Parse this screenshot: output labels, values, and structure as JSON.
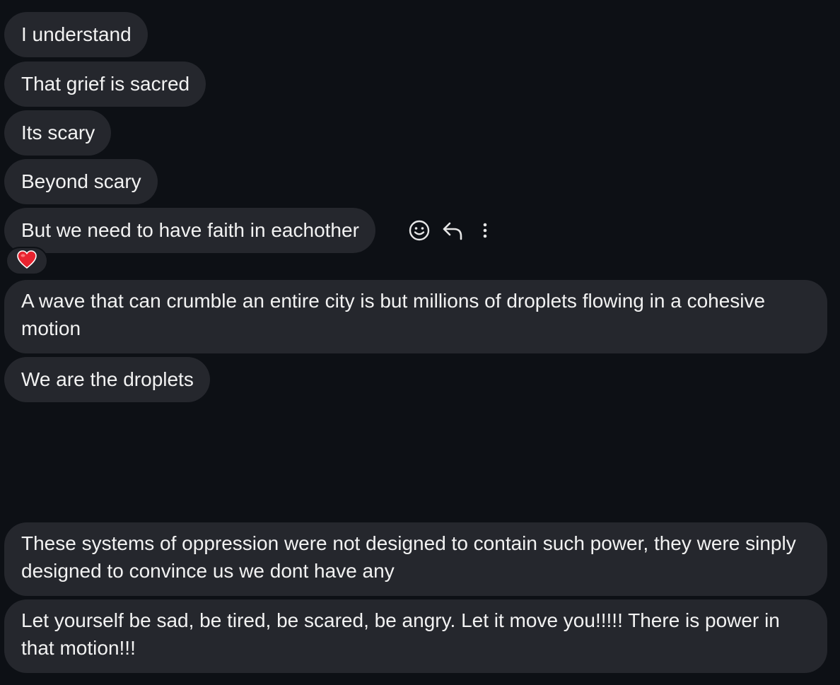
{
  "messages": [
    {
      "text": "I understand"
    },
    {
      "text": "That grief is sacred"
    },
    {
      "text": "Its scary"
    },
    {
      "text": "Beyond scary"
    },
    {
      "text": "But we need to have faith in eachother"
    },
    {
      "text": "A wave that can crumble an entire city is but millions of droplets flowing in a cohesive motion"
    },
    {
      "text": "We are the droplets"
    },
    {
      "text": "These systems of oppression were not designed to contain such power, they were sinply designed to convince us we dont have any"
    },
    {
      "text": "Let yourself be sad, be tired, be scared, be angry. Let it move you!!!!! There is power in that motion!!!"
    }
  ],
  "hover_actions": [
    {
      "icon": "smiley-icon"
    },
    {
      "icon": "reply-arrow-icon"
    },
    {
      "icon": "vertical-ellipsis-icon"
    }
  ],
  "reaction": {
    "icon": "heart-icon",
    "color": "#e8232f"
  },
  "colors": {
    "background": "#0d1015",
    "bubble": "#25272d",
    "text": "#f2f2f2",
    "icon": "#e6e6e6"
  }
}
